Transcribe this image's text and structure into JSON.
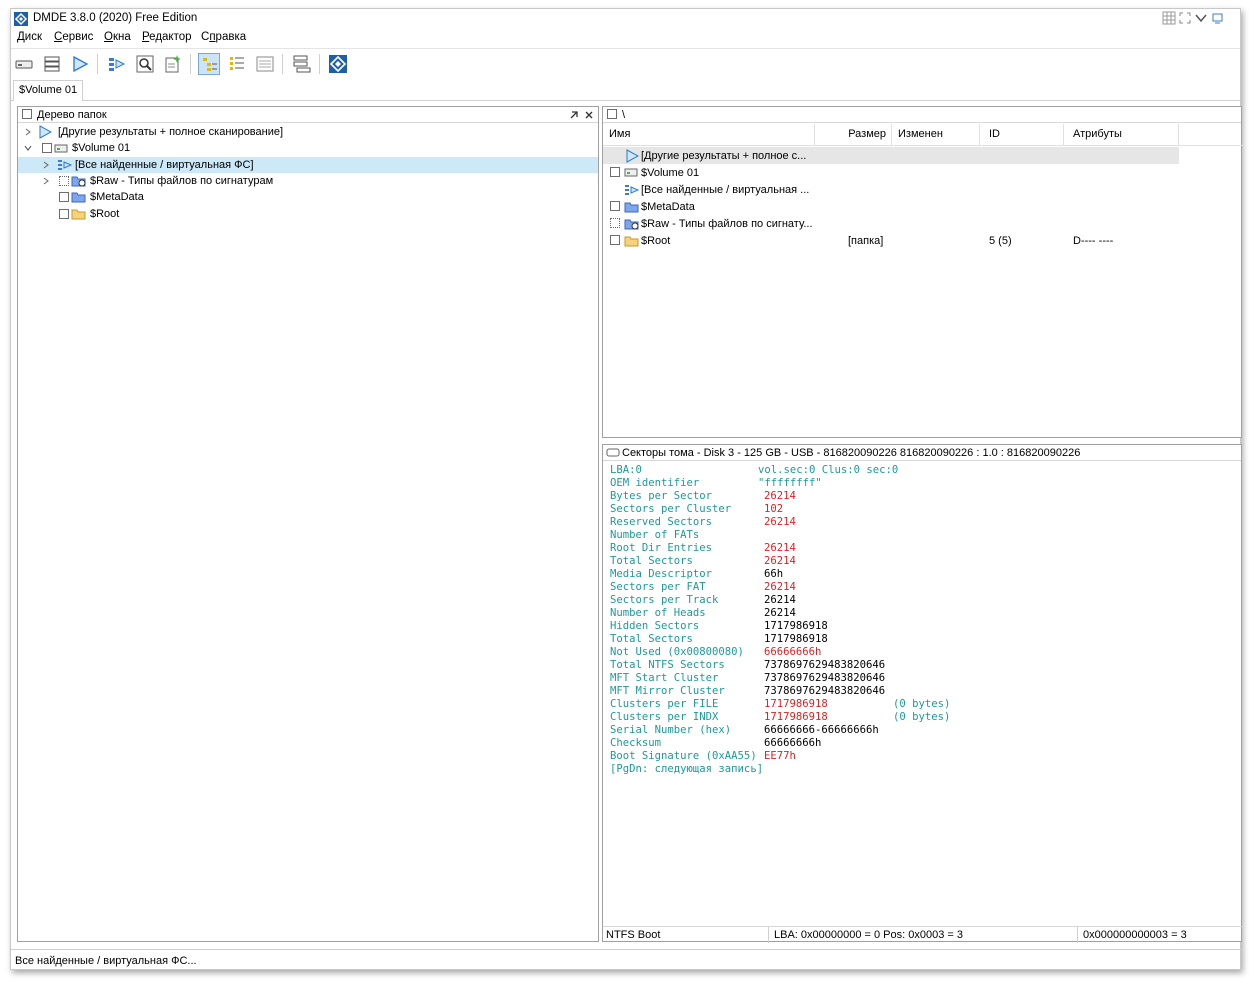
{
  "window": {
    "title": "DMDE 3.8.0 (2020) Free Edition"
  },
  "menu": {
    "items": [
      {
        "first": "Д",
        "rest": "иск"
      },
      {
        "first": "С",
        "rest": "ервис"
      },
      {
        "first": "О",
        "rest": "кна"
      },
      {
        "first": "Р",
        "rest": "едактор"
      },
      {
        "first": "",
        "rest": "Справка",
        "underline_index": 1
      }
    ],
    "help_a": "С",
    "help_b": "п",
    "help_c": "равка"
  },
  "tabs": {
    "active": "$Volume 01"
  },
  "tree": {
    "title": "Дерево папок",
    "items": [
      {
        "label": "[Другие результаты + полное сканирование]"
      },
      {
        "label": "$Volume 01"
      },
      {
        "label": "[Все найденные / виртуальная ФС]"
      },
      {
        "label": "$Raw - Типы файлов по сигнатурам"
      },
      {
        "label": "$MetaData"
      },
      {
        "label": "$Root"
      }
    ]
  },
  "filelist": {
    "path": "\\",
    "columns": [
      "Имя",
      "Размер",
      "Изменен",
      "ID",
      "Атрибуты"
    ],
    "rows": [
      {
        "name": "[Другие результаты + полное с...",
        "size": "",
        "id": "",
        "attrs": ""
      },
      {
        "name": "$Volume 01",
        "size": "",
        "id": "",
        "attrs": ""
      },
      {
        "name": "[Все найденные / виртуальная ...",
        "size": "",
        "id": "",
        "attrs": ""
      },
      {
        "name": "$MetaData",
        "size": "",
        "id": "",
        "attrs": ""
      },
      {
        "name": "$Raw - Типы файлов по сигнату...",
        "size": "",
        "id": "",
        "attrs": ""
      },
      {
        "name": "$Root",
        "size": "[папка]",
        "id": "5 (5)",
        "attrs": "D---- ----"
      }
    ]
  },
  "sectors": {
    "title": "Секторы тома - Disk 3 - 125 GB - USB - 816820090226 816820090226 : 1.0 : 816820090226",
    "header_left": "LBA:0",
    "header_right": "vol.sec:0 Clus:0 sec:0",
    "lines": [
      {
        "key": "OEM identifier",
        "val": "\"ffffffff\"",
        "color": "k",
        "note": ""
      },
      {
        "key": "Bytes per Sector",
        "val": "26214",
        "color": "r",
        "note": ""
      },
      {
        "key": "Sectors per Cluster",
        "val": "102",
        "color": "r",
        "note": ""
      },
      {
        "key": "Reserved Sectors",
        "val": "26214",
        "color": "r",
        "note": ""
      },
      {
        "key": "Number of FATs",
        "val": "",
        "color": "r",
        "note": ""
      },
      {
        "key": "Root Dir Entries",
        "val": "26214",
        "color": "r",
        "note": ""
      },
      {
        "key": "Total Sectors",
        "val": "26214",
        "color": "r",
        "note": ""
      },
      {
        "key": "Media Descriptor",
        "val": "66h",
        "color": "b",
        "note": ""
      },
      {
        "key": "Sectors per FAT",
        "val": "26214",
        "color": "r",
        "note": ""
      },
      {
        "key": "Sectors per Track",
        "val": "26214",
        "color": "b",
        "note": ""
      },
      {
        "key": "Number of Heads",
        "val": "26214",
        "color": "b",
        "note": ""
      },
      {
        "key": "Hidden Sectors",
        "val": "1717986918",
        "color": "b",
        "note": ""
      },
      {
        "key": "Total Sectors",
        "val": "1717986918",
        "color": "b",
        "note": ""
      },
      {
        "key": "Not Used (0x00800080)",
        "val": "66666666h",
        "color": "r",
        "note": ""
      },
      {
        "key": "Total NTFS Sectors",
        "val": "7378697629483820646",
        "color": "b",
        "note": ""
      },
      {
        "key": "MFT Start Cluster",
        "val": "7378697629483820646",
        "color": "b",
        "note": ""
      },
      {
        "key": "MFT Mirror Cluster",
        "val": "7378697629483820646",
        "color": "b",
        "note": ""
      },
      {
        "key": "Clusters per FILE",
        "val": "1717986918",
        "color": "r",
        "note": "(0 bytes)"
      },
      {
        "key": "Clusters per INDX",
        "val": "1717986918",
        "color": "r",
        "note": "(0 bytes)"
      },
      {
        "key": "Serial Number (hex)",
        "val": "66666666-66666666h",
        "color": "b",
        "note": ""
      },
      {
        "key": "Checksum",
        "val": "66666666h",
        "color": "b",
        "note": ""
      },
      {
        "key": "Boot Signature (0xAA55)",
        "val": "EE77h",
        "color": "r",
        "note": ""
      }
    ],
    "footer_line": "[PgDn: следующая запись]",
    "status_type": "NTFS Boot",
    "status_lba": "LBA: 0x00000000 = 0  Pos: 0x0003 = 3",
    "status_off": "0x000000000003 = 3"
  },
  "statusbar": {
    "text": "Все найденные / виртуальная ФС..."
  },
  "colors": {
    "key_teal": "#1c9a9a",
    "value_red": "#e02020",
    "selection": "#cde8f7",
    "folder_yellow": "#f6d37a",
    "folder_blue": "#5b8ee6"
  },
  "icons": [
    "app-logo-icon",
    "disk-icon",
    "partitions-icon",
    "play-icon",
    "files-icon",
    "search-icon",
    "new-icon",
    "tree-view-icon",
    "list-view-icon",
    "details-view-icon",
    "recover-icon",
    "logo-icon"
  ]
}
